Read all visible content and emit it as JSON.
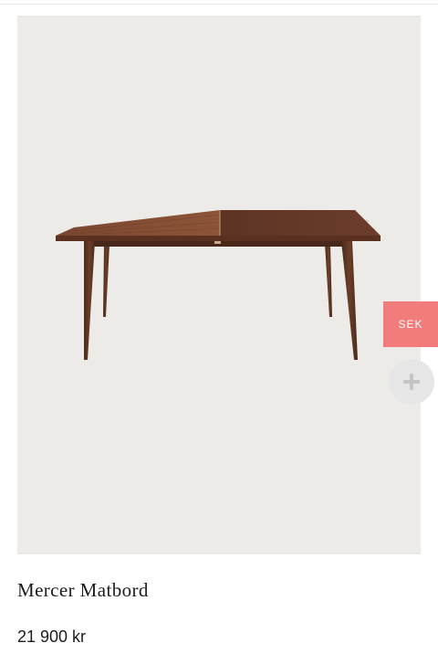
{
  "product": {
    "title": "Mercer Matbord",
    "price": "21 900 kr",
    "image_background": "#edebe8"
  },
  "currency_tab": {
    "label": "SEK",
    "color": "#f27c7c"
  },
  "add_button": {
    "icon": "plus-icon"
  }
}
